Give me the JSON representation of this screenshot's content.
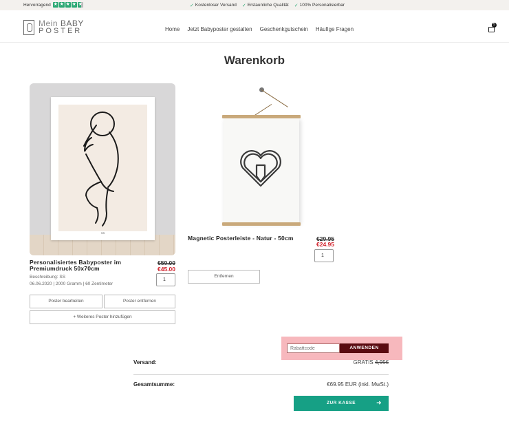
{
  "topbar": {
    "rating_label": "Hervorragend",
    "usps": [
      "Kostenloser Versand",
      "Erstaunliche Qualität",
      "100% Personalisierbar"
    ]
  },
  "header": {
    "logo": {
      "line1_thin": "Mein ",
      "line1_bold": "BABY",
      "line2": "POSTER"
    },
    "nav": [
      "Home",
      "Jetzt Babyposter gestalten",
      "Geschenkgutschein",
      "Häufige Fragen"
    ],
    "cart_count": "5"
  },
  "page_title": "Warenkorb",
  "product1": {
    "title_line1": "Personalisiertes Babyposter im",
    "title_line2": "Premiumdruck 50x70cm",
    "old_price": "€59.00",
    "new_price": "€45.00",
    "meta_line1": "Beschreibung: SS",
    "meta_line2": "06.06.2020 | 2000 Gramm | 60 Zentimeter",
    "qty": "1",
    "edit_label": "Poster bearbeiten",
    "remove_label": "Poster entfernen",
    "add_label": "+ Weiteres Poster hinzufügen",
    "poster_name": "SS"
  },
  "product2": {
    "title": "Magnetic Posterleiste - Natur - 50cm",
    "old_price": "€29.95",
    "new_price": "€24.95",
    "qty": "1",
    "remove_label": "Entfernen"
  },
  "coupon": {
    "placeholder": "Rabattcode",
    "button_label": "ANWENDEN"
  },
  "summary": {
    "shipping_label": "Versand:",
    "shipping_free": "GRATIS",
    "shipping_old": "4,95€",
    "total_label": "Gesamtsumme:",
    "total_value": "€69.95 EUR (inkl. MwSt.)"
  },
  "checkout_label": "ZUR KASSE",
  "colors": {
    "accent": "#16a085",
    "sale": "#d1202a",
    "coupon_highlight": "#f7b8bd",
    "coupon_button": "#5a0a10"
  }
}
